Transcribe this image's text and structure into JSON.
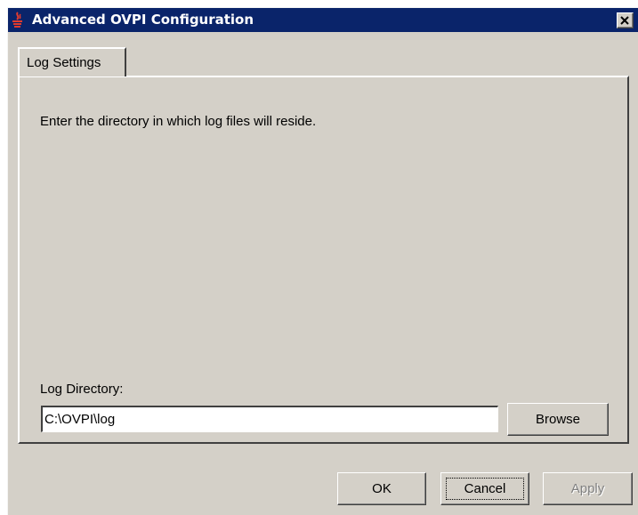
{
  "window": {
    "title": "Advanced OVPI Configuration",
    "icon": "java-cup-icon",
    "close_icon": "close-icon",
    "titlebar_color": "#0a246a",
    "face_color": "#d4d0c8"
  },
  "tabs": [
    {
      "label": "Log Settings",
      "selected": true
    }
  ],
  "log_settings": {
    "instruction": "Enter the directory in which log files will reside.",
    "directory_label": "Log Directory:",
    "directory_value": "C:\\OVPI\\log",
    "browse_label": "Browse"
  },
  "buttons": {
    "ok": "OK",
    "cancel": "Cancel",
    "apply": "Apply",
    "apply_enabled": false,
    "focused": "cancel"
  }
}
